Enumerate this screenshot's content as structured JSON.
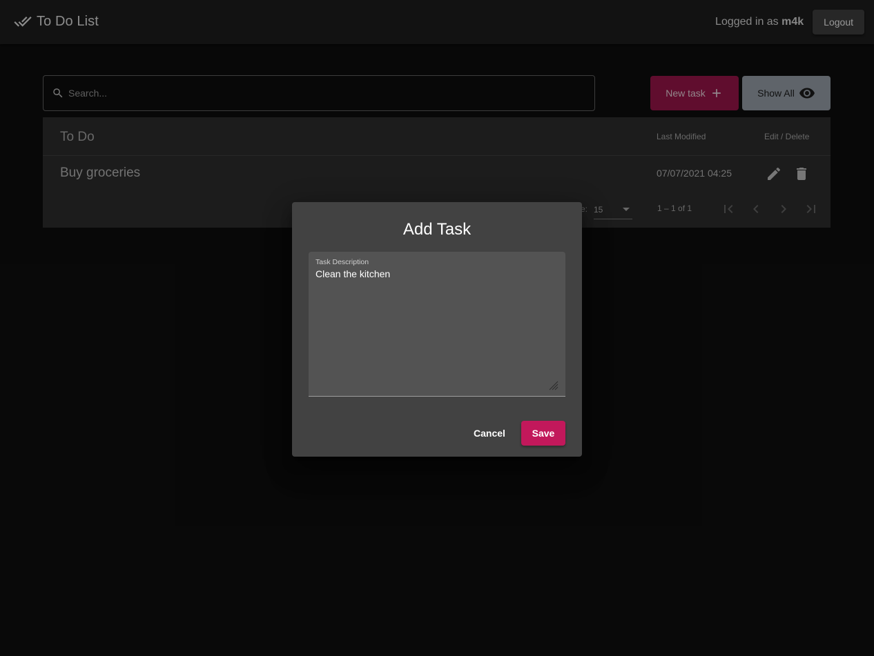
{
  "app": {
    "title": "To Do List",
    "logged_in_prefix": "Logged in as",
    "username": "m4k",
    "logout_label": "Logout"
  },
  "search": {
    "placeholder": "Search...",
    "value": ""
  },
  "toolbar": {
    "new_task_label": "New task",
    "show_all_label": "Show All"
  },
  "table": {
    "headers": {
      "todo": "To Do",
      "last_modified": "Last Modified",
      "edit_delete": "Edit / Delete"
    },
    "rows": [
      {
        "title": "Buy groceries",
        "last_modified": "07/07/2021 04:25"
      }
    ],
    "paginator": {
      "items_per_page_label": "e:",
      "page_size": "15",
      "range": "1 – 1 of 1"
    }
  },
  "dialog": {
    "title": "Add Task",
    "field_label": "Task Description",
    "field_value": "Clean the kitchen",
    "cancel_label": "Cancel",
    "save_label": "Save"
  },
  "colors": {
    "accent": "#c2185b",
    "new_task_bg": "#8e1445",
    "show_all_bg": "#8c949c",
    "background": "#0d0d0d",
    "toolbar_bg": "#1b1b1b",
    "dialog_bg": "#424242"
  },
  "icons": {
    "brand": "double-check-icon",
    "search": "search-icon",
    "new_task": "plus-icon",
    "show_all": "eye-icon",
    "edit": "pencil-icon",
    "delete": "trash-icon",
    "first_page": "first-page-icon",
    "prev_page": "chevron-left-icon",
    "next_page": "chevron-right-icon",
    "last_page": "last-page-icon"
  }
}
